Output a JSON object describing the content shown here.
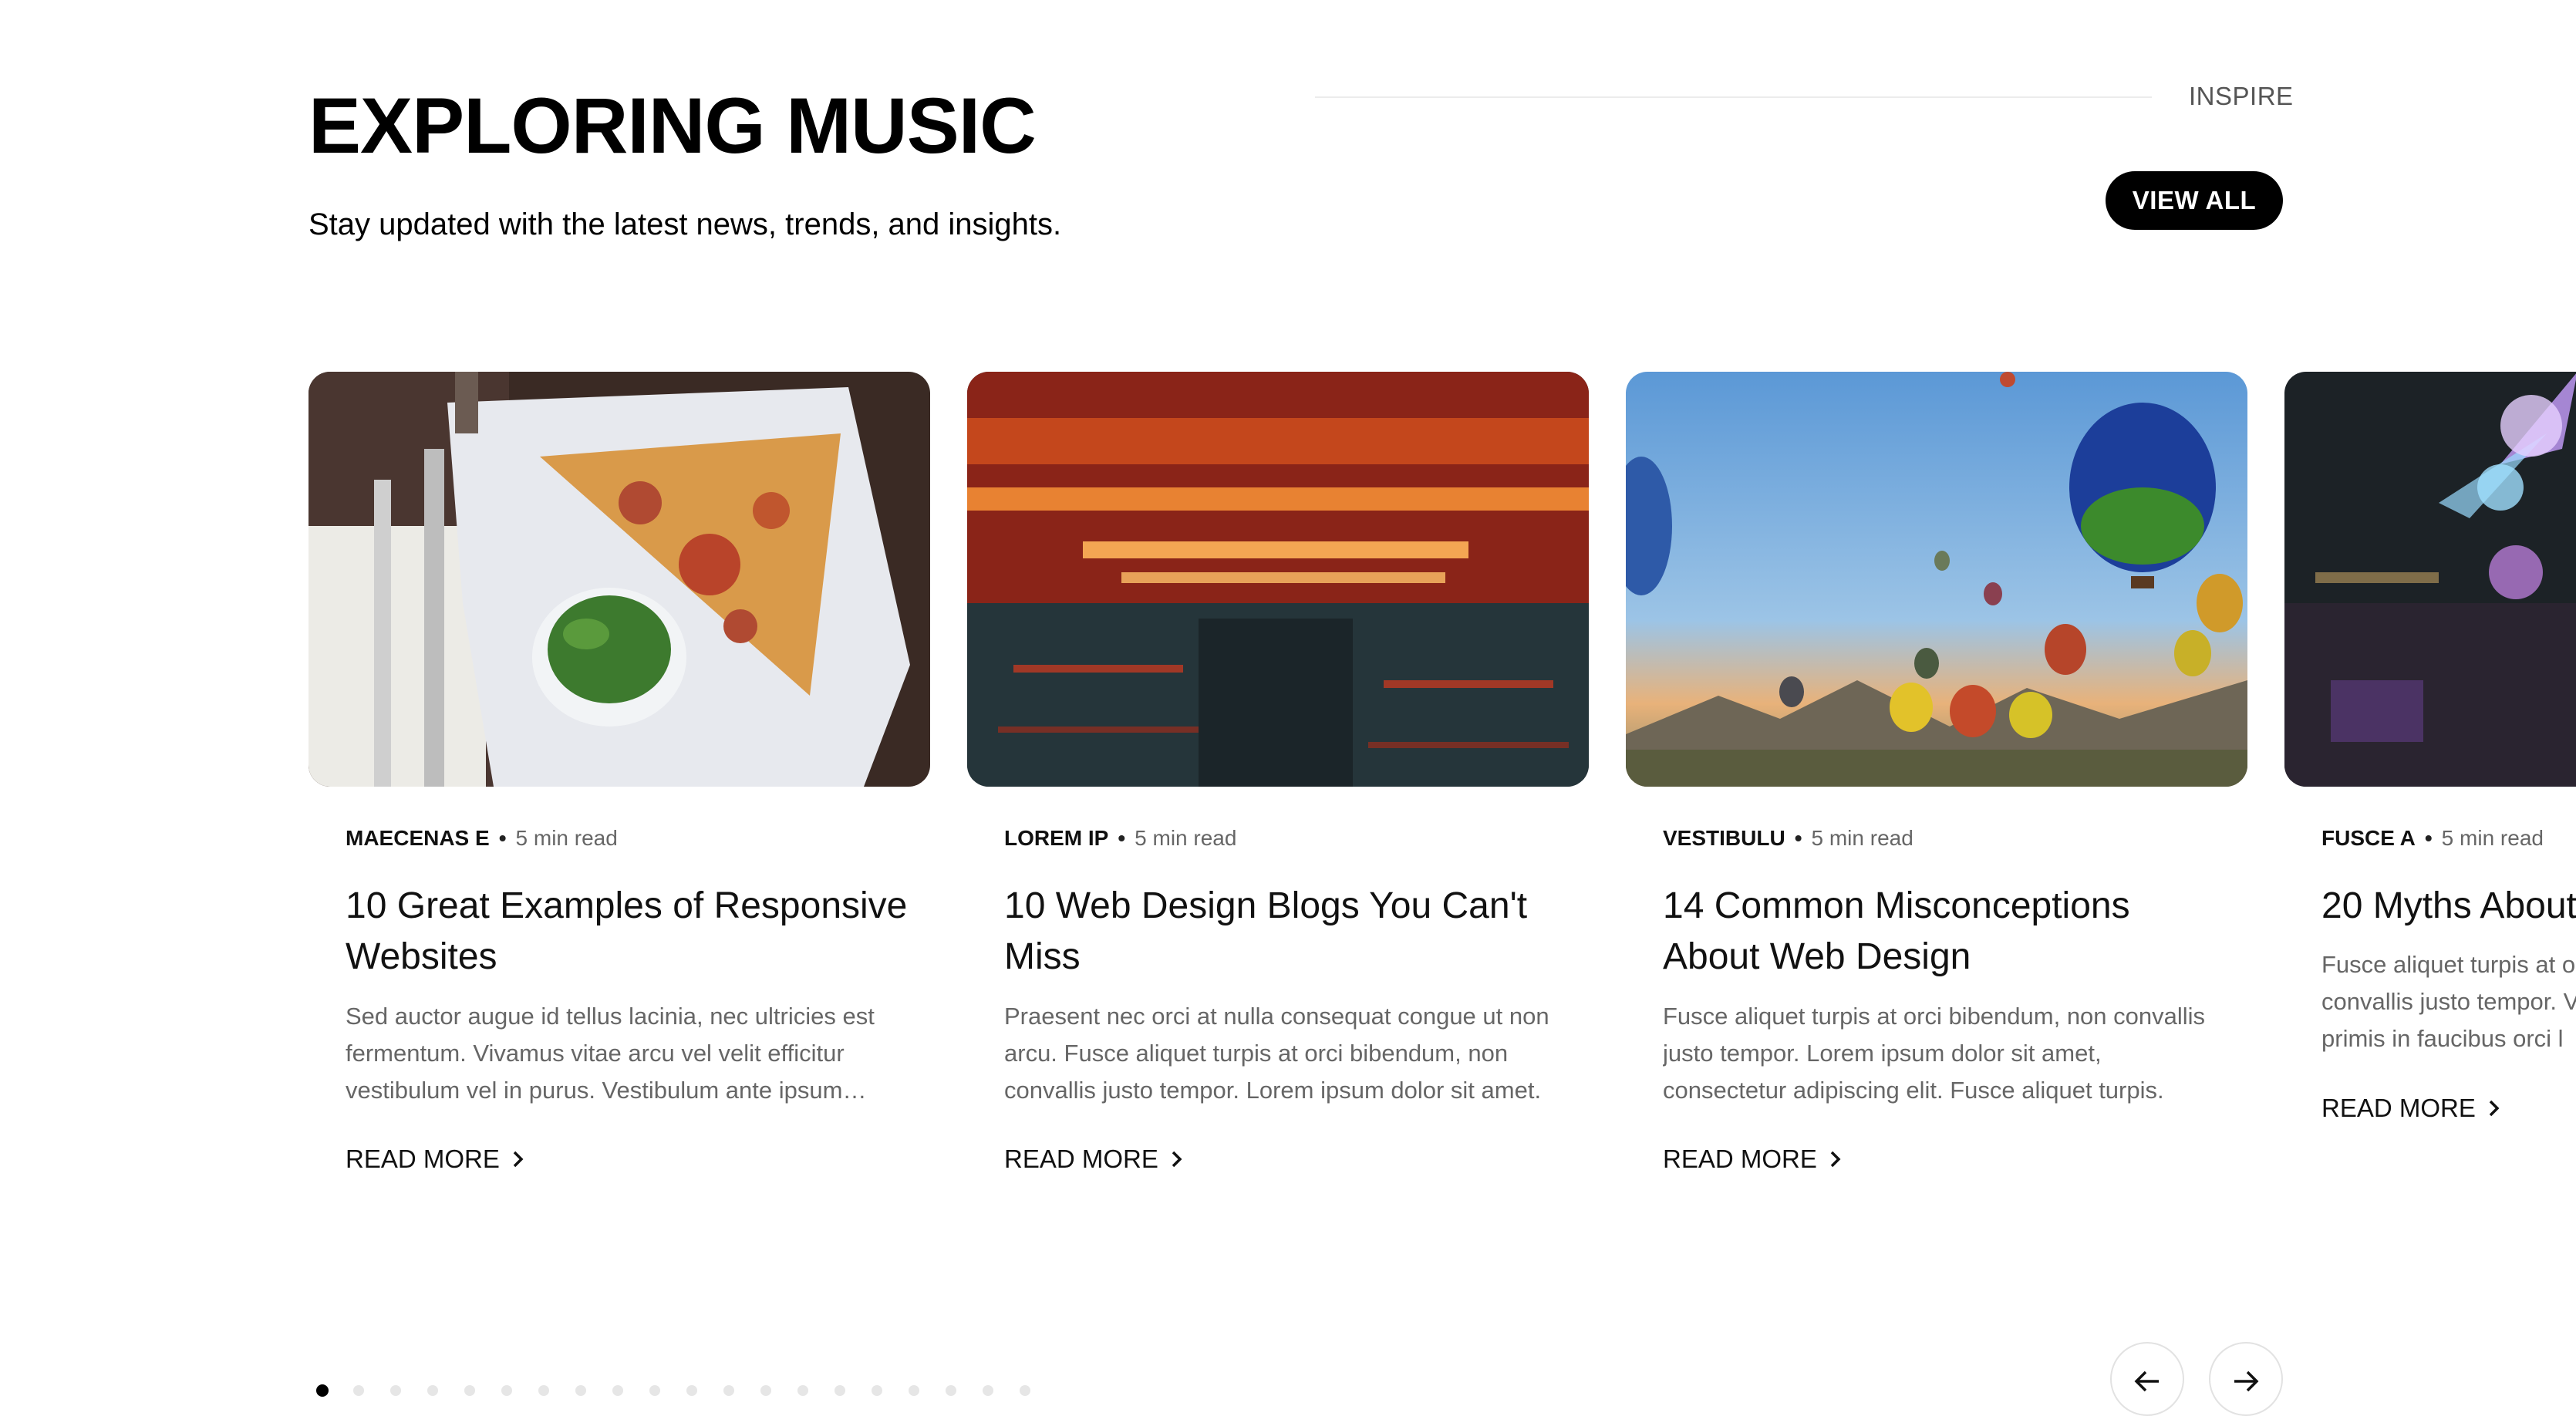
{
  "header": {
    "title": "EXPLORING MUSIC",
    "subtitle": "Stay updated with the latest news, trends, and insights.",
    "section_tag": "INSPIRE",
    "view_all_label": "VIEW ALL"
  },
  "cards": [
    {
      "image": "pizza-plate-photo",
      "category": "MAECENAS E",
      "read_time": "5 min read",
      "title": "10 Great Examples of Responsive Websites",
      "excerpt": "Sed auctor augue id tellus lacinia, nec ultricies est fermentum. Vivamus vitae arcu vel velit efficitur vestibulum vel in purus. Vestibulum ante ipsum primis in faucibus.",
      "read_more": "READ MORE"
    },
    {
      "image": "neon-lights-photo",
      "category": "LOREM IP",
      "read_time": "5 min read",
      "title": "10 Web Design Blogs You Can't Miss",
      "excerpt": "Praesent nec orci at nulla consequat congue ut non arcu. Fusce aliquet turpis at orci bibendum, non convallis justo tempor. Lorem ipsum dolor sit amet.",
      "read_more": "READ MORE"
    },
    {
      "image": "hot-air-balloons-photo",
      "category": "VESTIBULU",
      "read_time": "5 min read",
      "title": "14 Common Misconceptions About Web Design",
      "excerpt": "Fusce aliquet turpis at orci bibendum, non convallis justo tempor. Lorem ipsum dolor sit amet, consectetur adipiscing elit. Fusce aliquet turpis.",
      "read_more": "READ MORE"
    },
    {
      "image": "concert-stage-photo",
      "category": "FUSCE A",
      "read_time": "5 min read",
      "title": "20 Myths About",
      "excerpt": "Fusce aliquet turpis at o convallis justo tempor. V primis in faucibus orci l",
      "read_more": "READ MORE"
    }
  ],
  "pagination": {
    "active_index": 0,
    "prev_icon": "arrow-left-icon",
    "next_icon": "arrow-right-icon"
  }
}
